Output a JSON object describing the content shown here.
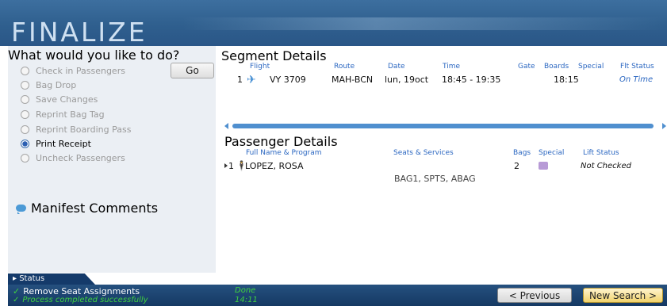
{
  "header": {
    "title": "FINALIZE"
  },
  "actions": {
    "question": "What would you like to do?",
    "go_label": "Go",
    "options": [
      {
        "label": "Check in Passengers",
        "selected": false,
        "enabled": false
      },
      {
        "label": "Bag Drop",
        "selected": false,
        "enabled": false
      },
      {
        "label": "Save Changes",
        "selected": false,
        "enabled": false
      },
      {
        "label": "Reprint Bag Tag",
        "selected": false,
        "enabled": false
      },
      {
        "label": "Reprint Boarding Pass",
        "selected": false,
        "enabled": false
      },
      {
        "label": "Print Receipt",
        "selected": true,
        "enabled": true
      },
      {
        "label": "Uncheck Passengers",
        "selected": false,
        "enabled": false
      }
    ]
  },
  "manifest": {
    "title": "Manifest Comments"
  },
  "segment": {
    "title": "Segment Details",
    "headers": {
      "flight": "Flight",
      "route": "Route",
      "date": "Date",
      "time": "Time",
      "gate": "Gate",
      "boards": "Boards",
      "special": "Special",
      "flt_status": "Flt Status"
    },
    "row": {
      "index": "1",
      "flight": "VY  3709",
      "route": "MAH-BCN",
      "date": "lun, 19oct",
      "time": "18:45 - 19:35",
      "gate": "",
      "boards": "18:15",
      "special": "",
      "flt_status": "On Time"
    }
  },
  "passengers": {
    "title": "Passenger Details",
    "headers": {
      "name": "Full Name & Program",
      "seats": "Seats & Services",
      "bags": "Bags",
      "special": "Special",
      "lift": "Lift Status"
    },
    "row": {
      "index": "1",
      "name": "LOPEZ, ROSA",
      "services": "BAG1, SPTS, ABAG",
      "bags": "2",
      "lift": "Not Checked"
    }
  },
  "status": {
    "tab_label": "Status",
    "action": "Remove Seat Assignments",
    "message": "Process completed successfully",
    "result": "Done",
    "time": "14:11"
  },
  "nav": {
    "previous": "< Previous",
    "next": "New Search >"
  },
  "colors": {
    "header": "#2f5f8e",
    "accent": "#2b67c1",
    "success": "#3fd13f",
    "statusbar": "#153963"
  }
}
